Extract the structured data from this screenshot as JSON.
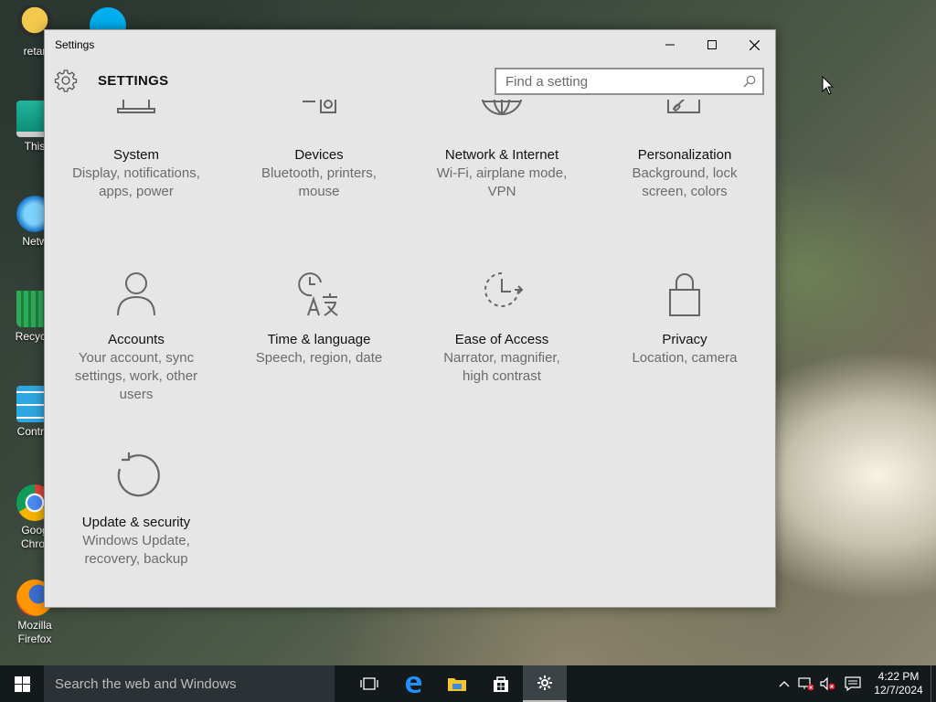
{
  "desktop": {
    "icons": [
      {
        "label": "retar",
        "icon": "user-icon"
      },
      {
        "label": "This",
        "icon": "computer-icon"
      },
      {
        "label": "Netw",
        "icon": "network-globe-icon"
      },
      {
        "label": "Recycle",
        "icon": "recycle-bin-icon"
      },
      {
        "label": "Control",
        "icon": "control-panel-icon"
      },
      {
        "label": "Goog Chror",
        "icon": "chrome-icon"
      },
      {
        "label": "Mozilla Firefox",
        "icon": "firefox-icon"
      }
    ]
  },
  "window": {
    "title": "Settings",
    "controls": {
      "minimize": "minimize-icon",
      "maximize": "maximize-icon",
      "close": "close-icon"
    }
  },
  "header": {
    "heading": "SETTINGS",
    "search_placeholder": "Find a setting"
  },
  "tiles": [
    {
      "name": "System",
      "desc1": "Display, notifications,",
      "desc2": "apps, power",
      "desc3": "",
      "icon": "laptop-icon"
    },
    {
      "name": "Devices",
      "desc1": "Bluetooth, printers,",
      "desc2": "mouse",
      "desc3": "",
      "icon": "devices-icon"
    },
    {
      "name": "Network & Internet",
      "desc1": "Wi-Fi, airplane mode,",
      "desc2": "VPN",
      "desc3": "",
      "icon": "globe-icon"
    },
    {
      "name": "Personalization",
      "desc1": "Background, lock",
      "desc2": "screen, colors",
      "desc3": "",
      "icon": "paint-icon"
    },
    {
      "name": "Accounts",
      "desc1": "Your account, sync",
      "desc2": "settings, work, other",
      "desc3": "users",
      "icon": "person-icon"
    },
    {
      "name": "Time & language",
      "desc1": "Speech, region, date",
      "desc2": "",
      "desc3": "",
      "icon": "time-language-icon"
    },
    {
      "name": "Ease of Access",
      "desc1": "Narrator, magnifier,",
      "desc2": "high contrast",
      "desc3": "",
      "icon": "ease-of-access-icon"
    },
    {
      "name": "Privacy",
      "desc1": "Location, camera",
      "desc2": "",
      "desc3": "",
      "icon": "lock-icon"
    },
    {
      "name": "Update & security",
      "desc1": "Windows Update,",
      "desc2": "recovery, backup",
      "desc3": "",
      "icon": "update-icon"
    }
  ],
  "taskbar": {
    "search_placeholder": "Search the web and Windows",
    "apps": [
      "task-view-icon",
      "edge-icon",
      "file-explorer-icon",
      "store-icon",
      "settings-gear-icon"
    ],
    "time": "4:22 PM",
    "date": "12/7/2024"
  }
}
